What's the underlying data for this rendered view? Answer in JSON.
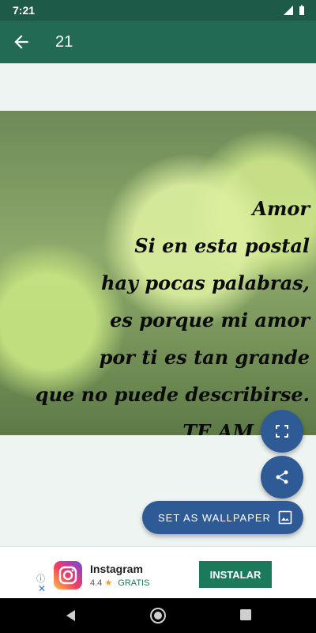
{
  "status": {
    "time": "7:21"
  },
  "appbar": {
    "title": "21"
  },
  "quote": {
    "lines": [
      "Amor",
      "Si en esta postal",
      "hay pocas palabras,",
      "es porque mi amor",
      "por ti es tan grande",
      "que no puede describirse.",
      "TE AM..."
    ]
  },
  "buttons": {
    "wallpaper_label": "SET AS WALLPAPER"
  },
  "ad": {
    "app_name": "Instagram",
    "rating": "4.4",
    "price": "GRATIS",
    "install_label": "INSTALAR"
  },
  "icons": {
    "back": "arrow-back-icon",
    "expand": "fullscreen-icon",
    "share": "share-icon",
    "wallpaper": "wallpaper-icon"
  },
  "colors": {
    "primary": "#226a54",
    "fab": "#2e5a96",
    "install": "#1b7a5c"
  }
}
